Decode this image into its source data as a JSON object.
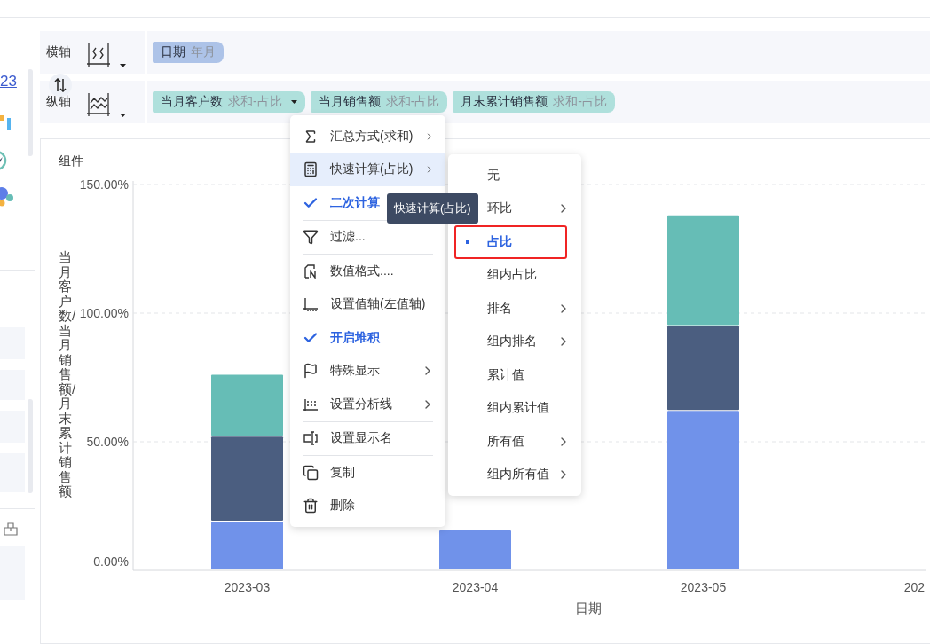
{
  "sidebar": {
    "label": "23"
  },
  "axes": [
    {
      "label": "横轴",
      "pills": [
        {
          "name": "日期",
          "detail": "年月",
          "kind": "dimension",
          "dropdown": false
        }
      ]
    },
    {
      "label": "纵轴",
      "pills": [
        {
          "name": "当月客户数",
          "detail": "求和-占比",
          "kind": "measure",
          "dropdown": true
        },
        {
          "name": "当月销售额",
          "detail": "求和-占比",
          "kind": "measure",
          "dropdown": false
        },
        {
          "name": "月末累计销售额",
          "detail": "求和-占比",
          "kind": "measure",
          "dropdown": false
        }
      ]
    }
  ],
  "card": {
    "title": "组件",
    "chart_data": {
      "type": "bar",
      "stacked": true,
      "xlabel": "日期",
      "ylabel": "当月客户数/当月销售额/月末累计销售额",
      "categories": [
        "2023-03",
        "2023-04",
        "2023-05",
        "202"
      ],
      "ylim": [
        0,
        1.5
      ],
      "yticks": [
        {
          "value": 0,
          "label": "0.00%"
        },
        {
          "value": 0.5,
          "label": "50.00%"
        },
        {
          "value": 1,
          "label": "100.00%"
        },
        {
          "value": 1.5,
          "label": "150.00%"
        }
      ],
      "series": [
        {
          "color": "#7092ea",
          "values": [
            0.19,
            0.155,
            0.62,
            null
          ]
        },
        {
          "color": "#4b5e80",
          "values": [
            0.33,
            null,
            0.33,
            null
          ]
        },
        {
          "color": "#66bdb6",
          "values": [
            0.24,
            null,
            0.43,
            null
          ]
        }
      ]
    }
  },
  "menu": {
    "items": [
      {
        "kind": "command",
        "label": "汇总方式(求和)",
        "submenu": true,
        "selected": false
      },
      {
        "kind": "command",
        "label": "快速计算(占比)",
        "submenu": true,
        "selected": true
      },
      {
        "kind": "toggle",
        "label": "二次计算",
        "checked": true,
        "submenu": false,
        "selected": false
      },
      {
        "kind": "divider"
      },
      {
        "kind": "command",
        "label": "过滤...",
        "submenu": false,
        "selected": false
      },
      {
        "kind": "divider"
      },
      {
        "kind": "command",
        "label": "数值格式....",
        "submenu": false,
        "selected": false
      },
      {
        "kind": "command",
        "label": "设置值轴(左值轴)",
        "submenu": false,
        "selected": false
      },
      {
        "kind": "toggle",
        "label": "开启堆积",
        "checked": true,
        "submenu": false,
        "selected": false
      },
      {
        "kind": "command",
        "label": "特殊显示",
        "submenu": true,
        "selected": false
      },
      {
        "kind": "command",
        "label": "设置分析线",
        "submenu": true,
        "selected": false
      },
      {
        "kind": "divider"
      },
      {
        "kind": "command",
        "label": "设置显示名",
        "submenu": false,
        "selected": false
      },
      {
        "kind": "divider"
      },
      {
        "kind": "command",
        "label": "复制",
        "submenu": false,
        "selected": false
      },
      {
        "kind": "command",
        "label": "删除",
        "submenu": false,
        "selected": false
      }
    ]
  },
  "submenu": {
    "items": [
      {
        "label": "无",
        "selected": false,
        "submenu": false,
        "outlined": false
      },
      {
        "label": "环比",
        "selected": false,
        "submenu": true,
        "outlined": false
      },
      {
        "label": "占比",
        "selected": true,
        "submenu": false,
        "outlined": true
      },
      {
        "label": "组内占比",
        "selected": false,
        "submenu": false,
        "outlined": false
      },
      {
        "label": "排名",
        "selected": false,
        "submenu": true,
        "outlined": false
      },
      {
        "label": "组内排名",
        "selected": false,
        "submenu": true,
        "outlined": false
      },
      {
        "label": "累计值",
        "selected": false,
        "submenu": false,
        "outlined": false
      },
      {
        "label": "组内累计值",
        "selected": false,
        "submenu": false,
        "outlined": false
      },
      {
        "label": "所有值",
        "selected": false,
        "submenu": true,
        "outlined": false
      },
      {
        "label": "组内所有值",
        "selected": false,
        "submenu": true,
        "outlined": false
      }
    ]
  },
  "tooltip": {
    "text": "快速计算(占比)"
  }
}
